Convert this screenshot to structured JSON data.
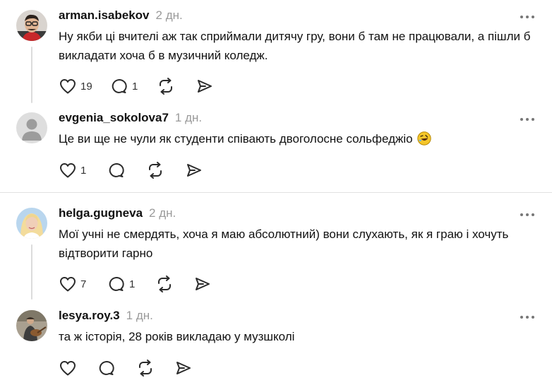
{
  "comments": [
    {
      "username": "arman.isabekov",
      "time": "2 дн.",
      "text": "Ну якби ці вчителі аж так сприймали дитячу гру, вони б там не працювали, а пішли б викладати хоча б в музичний коледж.",
      "likes": "19",
      "replies": "1",
      "avatar_icon": "avatar-glasses-man"
    },
    {
      "username": "evgenia_sokolova7",
      "time": "1 дн.",
      "text": "Це ви ще не чули як студенти співають двоголосне сольфеджіо",
      "emoji": "rolling-on-floor-laughing-emoji",
      "likes": "1",
      "replies": "",
      "avatar_icon": "default-user-avatar"
    },
    {
      "username": "helga.gugneva",
      "time": "2 дн.",
      "text": "Мої учні не смердять, хоча я маю абсолютний) вони слухають, як я граю і хочуть відтворити гарно",
      "likes": "7",
      "replies": "1",
      "avatar_icon": "avatar-blonde-woman"
    },
    {
      "username": "lesya.roy.3",
      "time": "1 дн.",
      "text": "та ж історія, 28 років викладаю у музшколі",
      "likes": "",
      "replies": "",
      "avatar_icon": "avatar-person-with-guitar"
    }
  ],
  "icons": {
    "like": "heart-icon",
    "reply": "comment-bubble-icon",
    "repost": "repost-icon",
    "share": "send-icon",
    "more": "more-dots-icon"
  },
  "colors": {
    "text": "#111111",
    "muted": "#9a9a9a",
    "icon": "#2b2b2b",
    "divider": "#e2e2e2"
  }
}
